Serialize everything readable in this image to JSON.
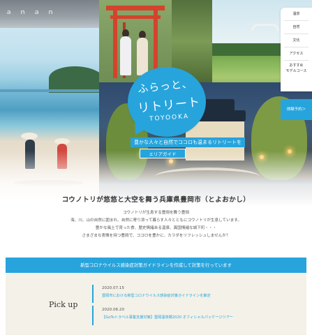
{
  "logo": {
    "text": "ａｎａｎ"
  },
  "nav": {
    "items": [
      "温泉",
      "自然",
      "文化",
      "アクセス",
      "おすすめ\nモデルコース"
    ],
    "booking": "体験予約＞"
  },
  "hero": {
    "slogan_line1": "ふらっと、",
    "slogan_line2": "リトリート",
    "slogan_line3": "TOYOOKA",
    "catch": "豊かな人々と自然でココロも温まるリトリートを",
    "area_button": "エリアガイド"
  },
  "intro": {
    "title": "コウノトリが悠悠と大空を舞う兵庫県豊岡市（とよおかし）",
    "lines": [
      "コウノトリが生息する豊岡を舞う豊岡",
      "海、川、山の自然に囲まれ、自然に寄り添って暮らす人々とともにコウノトリが生息しています。",
      "豊かな風土で育った食、歴史情緒ある温泉、異国情緒な城下町・・・",
      "さまざまな表情を持つ豊岡で、ココロを豊かに、カラダをリフレッシュしませんか？"
    ]
  },
  "banner": {
    "text": "新型コロナウイルス感染症対策ガイドラインを作成して対策を行っています"
  },
  "pickup": {
    "title": "Pick up",
    "news": [
      {
        "date": "2020.07.15",
        "title": "豊岡市における新型コロナウイルス感染症対策ガイドラインを策定"
      },
      {
        "date": "2020.06.20",
        "title": "【GoToトラベル事業支援対策】豊岡温泉郷2020 オフィシャルパッケージツアー"
      }
    ]
  },
  "colors": {
    "accent": "#27a4dc",
    "pickup_bg": "#f3f1e8"
  }
}
